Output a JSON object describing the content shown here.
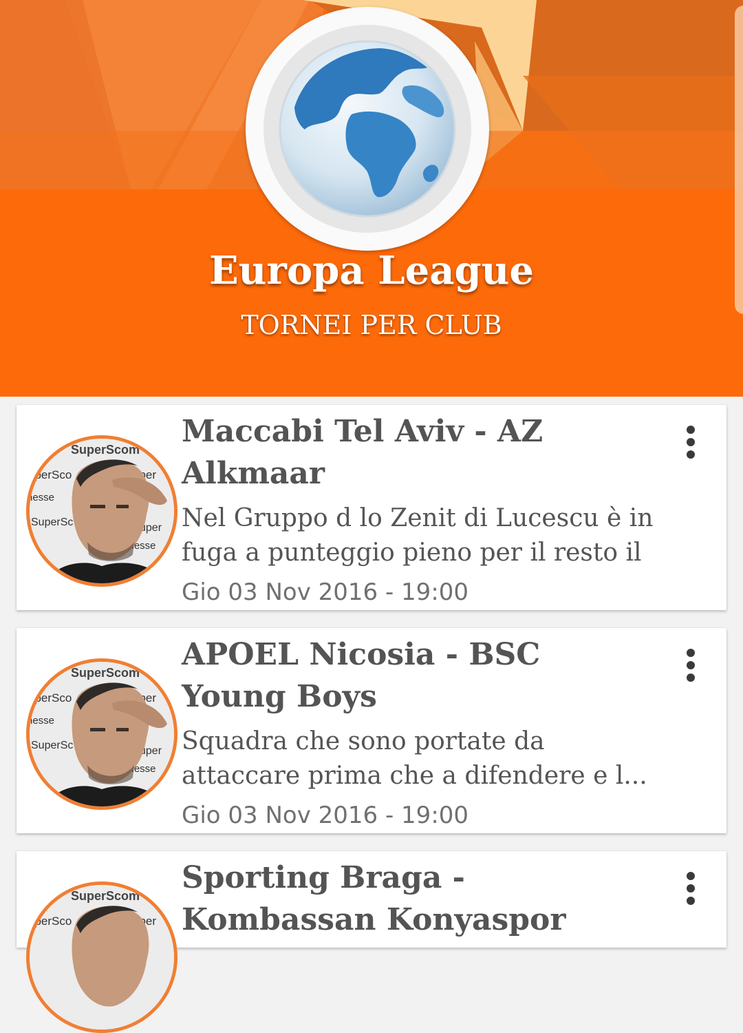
{
  "header": {
    "title": "Europa League",
    "subtitle": "TORNEI PER CLUB",
    "logo_icon": "globe-icon",
    "colors": {
      "primary": "#fd6a0a",
      "accent": "#f07f33",
      "light": "#ffffff"
    }
  },
  "events": [
    {
      "title": "Maccabi Tel Aviv - AZ Alkmaar",
      "summary": "Nel Gruppo d lo Zenit di Lucescu è in fuga a punteggio pieno per il resto il",
      "date": "Gio 03 Nov 2016 - 19:00",
      "avatar_text": [
        "SuperScom",
        "uperSco",
        "uper",
        "nesse",
        "SuperSc",
        "uper",
        "imesse"
      ],
      "menu_icon": "more-vertical-icon"
    },
    {
      "title": "APOEL Nicosia - BSC Young Boys",
      "summary": "Squadra che sono portate da attaccare prima che a difendere e l...",
      "date": "Gio 03 Nov 2016 - 19:00",
      "avatar_text": [
        "SuperScom",
        "uperSco",
        "uper",
        "nesse",
        "SuperSc",
        "uper",
        "imesse"
      ],
      "menu_icon": "more-vertical-icon"
    },
    {
      "title": "Sporting Braga - Kombassan Konyaspor",
      "summary": "",
      "date": "",
      "avatar_text": [
        "SuperScom",
        "uperSco",
        "uper"
      ],
      "menu_icon": "more-vertical-icon"
    }
  ]
}
